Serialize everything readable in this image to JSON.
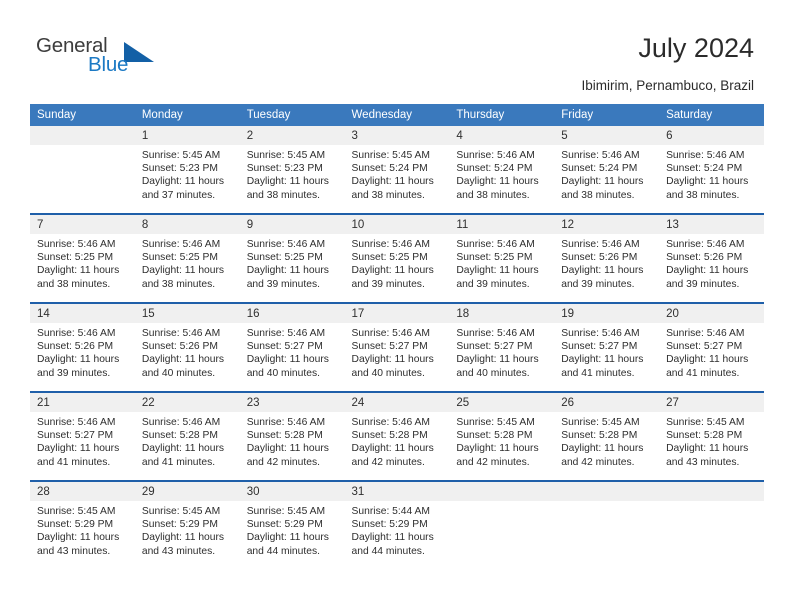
{
  "brand": {
    "name_top": "General",
    "name_bottom": "Blue",
    "triangle_color": "#1360a6",
    "blue_color": "#1b79c4"
  },
  "header": {
    "title": "July 2024",
    "subtitle": "Ibimirim, Pernambuco, Brazil"
  },
  "theme": {
    "header_bg": "#3a79bd",
    "week_separator": "#1f5fa9",
    "daynum_bg": "#f0f0f0"
  },
  "calendar": {
    "weekday_headers": [
      "Sunday",
      "Monday",
      "Tuesday",
      "Wednesday",
      "Thursday",
      "Friday",
      "Saturday"
    ],
    "weeks": [
      [
        {
          "day": "",
          "sunrise": "",
          "sunset": "",
          "daylight": ""
        },
        {
          "day": "1",
          "sunrise": "Sunrise: 5:45 AM",
          "sunset": "Sunset: 5:23 PM",
          "daylight": "Daylight: 11 hours and 37 minutes."
        },
        {
          "day": "2",
          "sunrise": "Sunrise: 5:45 AM",
          "sunset": "Sunset: 5:23 PM",
          "daylight": "Daylight: 11 hours and 38 minutes."
        },
        {
          "day": "3",
          "sunrise": "Sunrise: 5:45 AM",
          "sunset": "Sunset: 5:24 PM",
          "daylight": "Daylight: 11 hours and 38 minutes."
        },
        {
          "day": "4",
          "sunrise": "Sunrise: 5:46 AM",
          "sunset": "Sunset: 5:24 PM",
          "daylight": "Daylight: 11 hours and 38 minutes."
        },
        {
          "day": "5",
          "sunrise": "Sunrise: 5:46 AM",
          "sunset": "Sunset: 5:24 PM",
          "daylight": "Daylight: 11 hours and 38 minutes."
        },
        {
          "day": "6",
          "sunrise": "Sunrise: 5:46 AM",
          "sunset": "Sunset: 5:24 PM",
          "daylight": "Daylight: 11 hours and 38 minutes."
        }
      ],
      [
        {
          "day": "7",
          "sunrise": "Sunrise: 5:46 AM",
          "sunset": "Sunset: 5:25 PM",
          "daylight": "Daylight: 11 hours and 38 minutes."
        },
        {
          "day": "8",
          "sunrise": "Sunrise: 5:46 AM",
          "sunset": "Sunset: 5:25 PM",
          "daylight": "Daylight: 11 hours and 38 minutes."
        },
        {
          "day": "9",
          "sunrise": "Sunrise: 5:46 AM",
          "sunset": "Sunset: 5:25 PM",
          "daylight": "Daylight: 11 hours and 39 minutes."
        },
        {
          "day": "10",
          "sunrise": "Sunrise: 5:46 AM",
          "sunset": "Sunset: 5:25 PM",
          "daylight": "Daylight: 11 hours and 39 minutes."
        },
        {
          "day": "11",
          "sunrise": "Sunrise: 5:46 AM",
          "sunset": "Sunset: 5:25 PM",
          "daylight": "Daylight: 11 hours and 39 minutes."
        },
        {
          "day": "12",
          "sunrise": "Sunrise: 5:46 AM",
          "sunset": "Sunset: 5:26 PM",
          "daylight": "Daylight: 11 hours and 39 minutes."
        },
        {
          "day": "13",
          "sunrise": "Sunrise: 5:46 AM",
          "sunset": "Sunset: 5:26 PM",
          "daylight": "Daylight: 11 hours and 39 minutes."
        }
      ],
      [
        {
          "day": "14",
          "sunrise": "Sunrise: 5:46 AM",
          "sunset": "Sunset: 5:26 PM",
          "daylight": "Daylight: 11 hours and 39 minutes."
        },
        {
          "day": "15",
          "sunrise": "Sunrise: 5:46 AM",
          "sunset": "Sunset: 5:26 PM",
          "daylight": "Daylight: 11 hours and 40 minutes."
        },
        {
          "day": "16",
          "sunrise": "Sunrise: 5:46 AM",
          "sunset": "Sunset: 5:27 PM",
          "daylight": "Daylight: 11 hours and 40 minutes."
        },
        {
          "day": "17",
          "sunrise": "Sunrise: 5:46 AM",
          "sunset": "Sunset: 5:27 PM",
          "daylight": "Daylight: 11 hours and 40 minutes."
        },
        {
          "day": "18",
          "sunrise": "Sunrise: 5:46 AM",
          "sunset": "Sunset: 5:27 PM",
          "daylight": "Daylight: 11 hours and 40 minutes."
        },
        {
          "day": "19",
          "sunrise": "Sunrise: 5:46 AM",
          "sunset": "Sunset: 5:27 PM",
          "daylight": "Daylight: 11 hours and 41 minutes."
        },
        {
          "day": "20",
          "sunrise": "Sunrise: 5:46 AM",
          "sunset": "Sunset: 5:27 PM",
          "daylight": "Daylight: 11 hours and 41 minutes."
        }
      ],
      [
        {
          "day": "21",
          "sunrise": "Sunrise: 5:46 AM",
          "sunset": "Sunset: 5:27 PM",
          "daylight": "Daylight: 11 hours and 41 minutes."
        },
        {
          "day": "22",
          "sunrise": "Sunrise: 5:46 AM",
          "sunset": "Sunset: 5:28 PM",
          "daylight": "Daylight: 11 hours and 41 minutes."
        },
        {
          "day": "23",
          "sunrise": "Sunrise: 5:46 AM",
          "sunset": "Sunset: 5:28 PM",
          "daylight": "Daylight: 11 hours and 42 minutes."
        },
        {
          "day": "24",
          "sunrise": "Sunrise: 5:46 AM",
          "sunset": "Sunset: 5:28 PM",
          "daylight": "Daylight: 11 hours and 42 minutes."
        },
        {
          "day": "25",
          "sunrise": "Sunrise: 5:45 AM",
          "sunset": "Sunset: 5:28 PM",
          "daylight": "Daylight: 11 hours and 42 minutes."
        },
        {
          "day": "26",
          "sunrise": "Sunrise: 5:45 AM",
          "sunset": "Sunset: 5:28 PM",
          "daylight": "Daylight: 11 hours and 42 minutes."
        },
        {
          "day": "27",
          "sunrise": "Sunrise: 5:45 AM",
          "sunset": "Sunset: 5:28 PM",
          "daylight": "Daylight: 11 hours and 43 minutes."
        }
      ],
      [
        {
          "day": "28",
          "sunrise": "Sunrise: 5:45 AM",
          "sunset": "Sunset: 5:29 PM",
          "daylight": "Daylight: 11 hours and 43 minutes."
        },
        {
          "day": "29",
          "sunrise": "Sunrise: 5:45 AM",
          "sunset": "Sunset: 5:29 PM",
          "daylight": "Daylight: 11 hours and 43 minutes."
        },
        {
          "day": "30",
          "sunrise": "Sunrise: 5:45 AM",
          "sunset": "Sunset: 5:29 PM",
          "daylight": "Daylight: 11 hours and 44 minutes."
        },
        {
          "day": "31",
          "sunrise": "Sunrise: 5:44 AM",
          "sunset": "Sunset: 5:29 PM",
          "daylight": "Daylight: 11 hours and 44 minutes."
        },
        {
          "day": "",
          "sunrise": "",
          "sunset": "",
          "daylight": ""
        },
        {
          "day": "",
          "sunrise": "",
          "sunset": "",
          "daylight": ""
        },
        {
          "day": "",
          "sunrise": "",
          "sunset": "",
          "daylight": ""
        }
      ]
    ]
  }
}
